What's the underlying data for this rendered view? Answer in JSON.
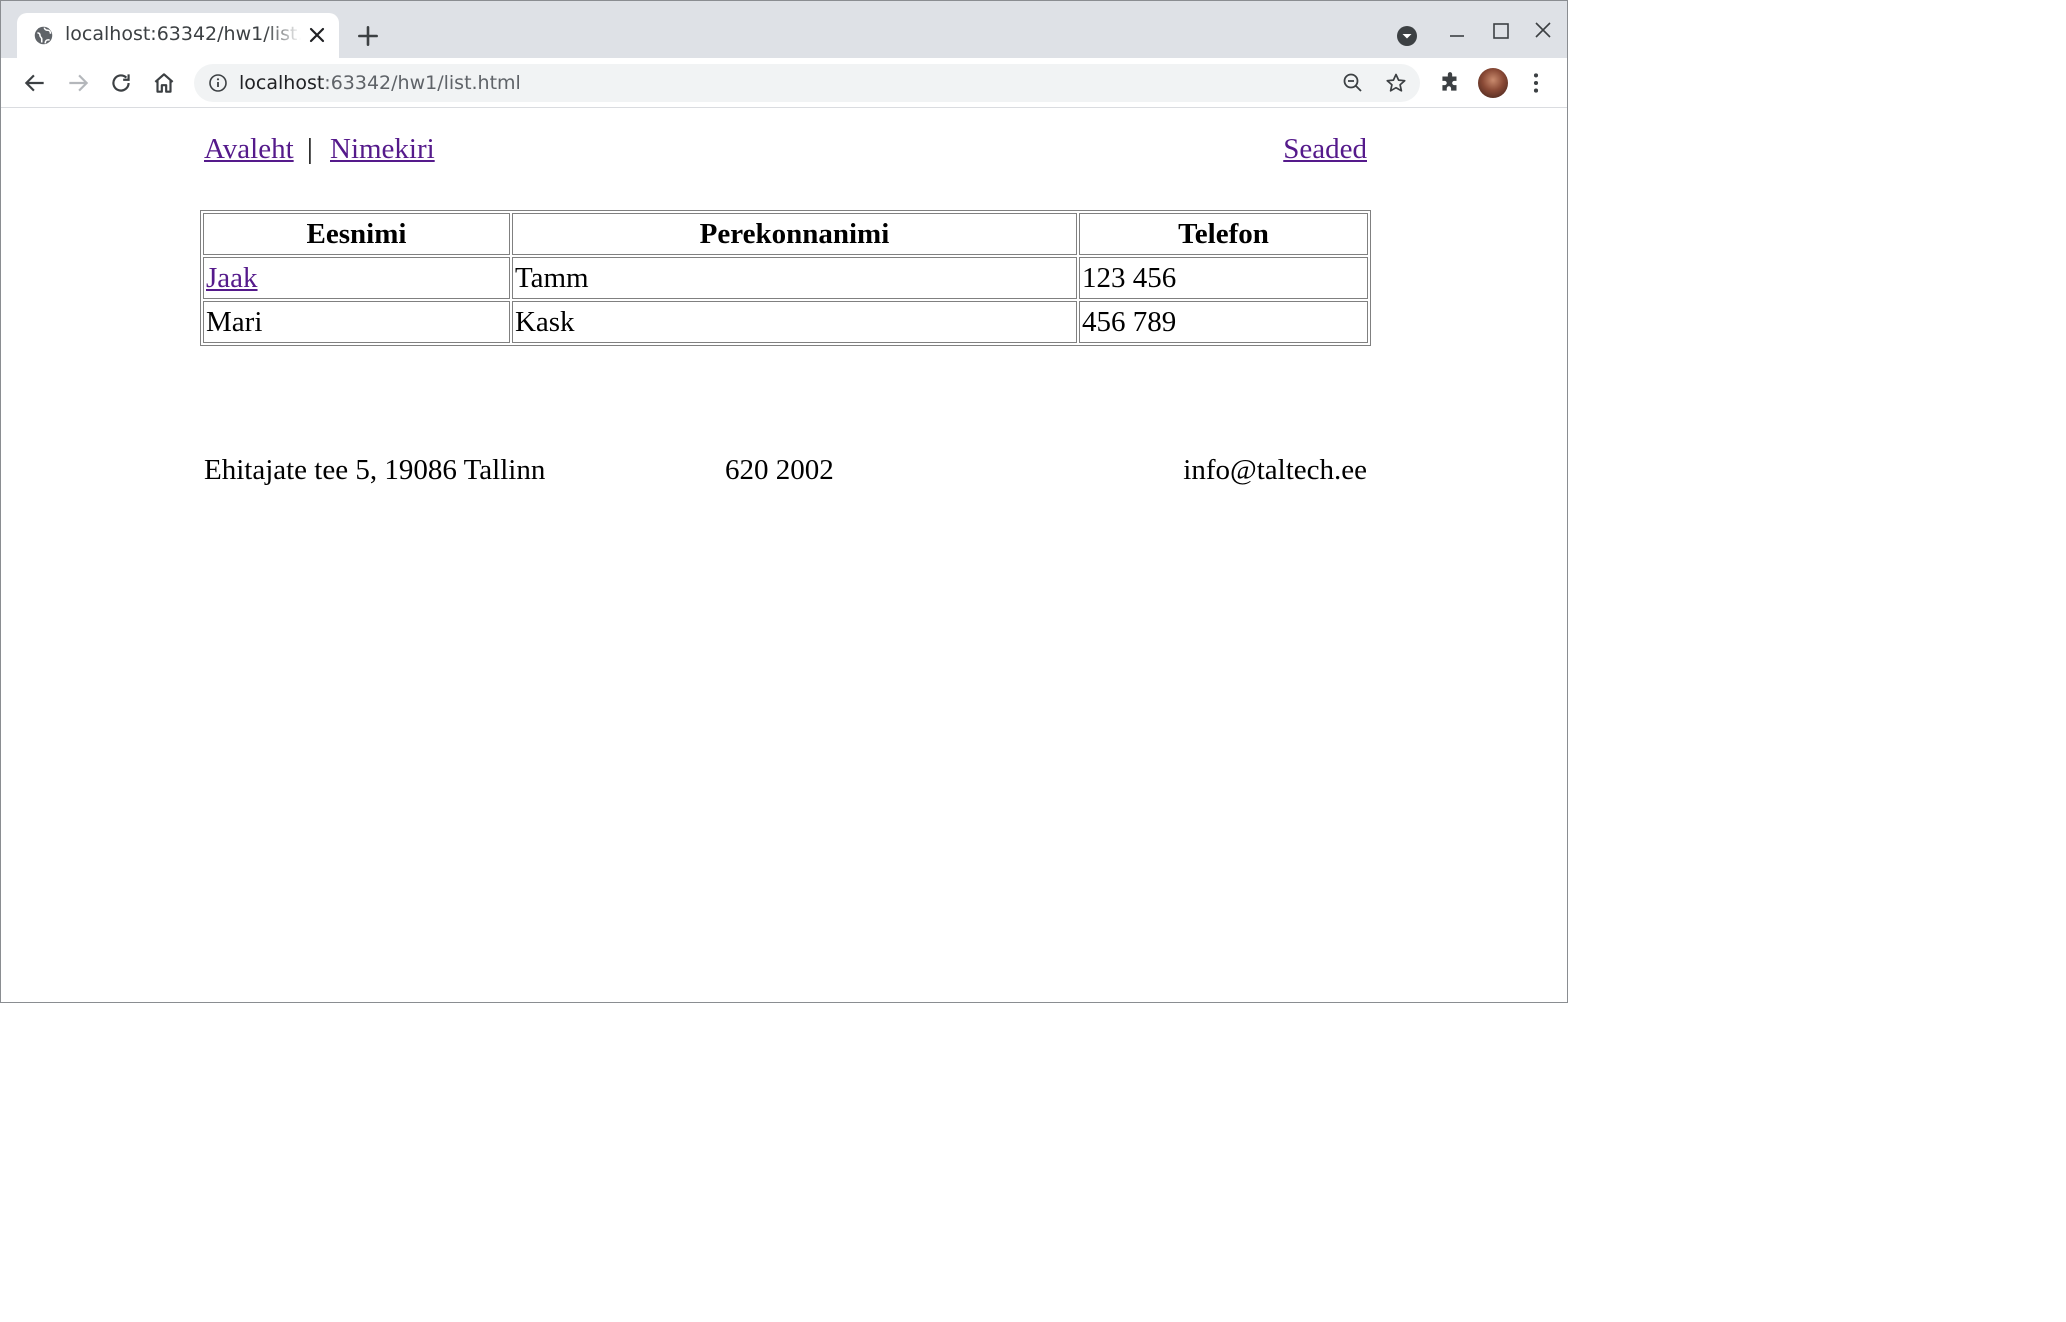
{
  "browser": {
    "tab_title": "localhost:63342/hw1/list.html",
    "url_host": "localhost",
    "url_rest": ":63342/hw1/list.html"
  },
  "nav": {
    "home": "Avaleht",
    "separator": "|",
    "list": "Nimekiri",
    "settings": "Seaded"
  },
  "table": {
    "headers": [
      "Eesnimi",
      "Perekonnanimi",
      "Telefon"
    ],
    "rows": [
      {
        "first": "Jaak",
        "last": "Tamm",
        "phone": "123 456"
      },
      {
        "first": "Mari",
        "last": "Kask",
        "phone": "456 789"
      }
    ]
  },
  "footer": {
    "address": "Ehitajate tee 5, 19086 Tallinn",
    "phone": "620 2002",
    "email": "info@taltech.ee"
  },
  "colors": {
    "link_visited": "#551a8b",
    "tabstrip": "#dee1e6",
    "omnibox": "#f1f3f4"
  }
}
